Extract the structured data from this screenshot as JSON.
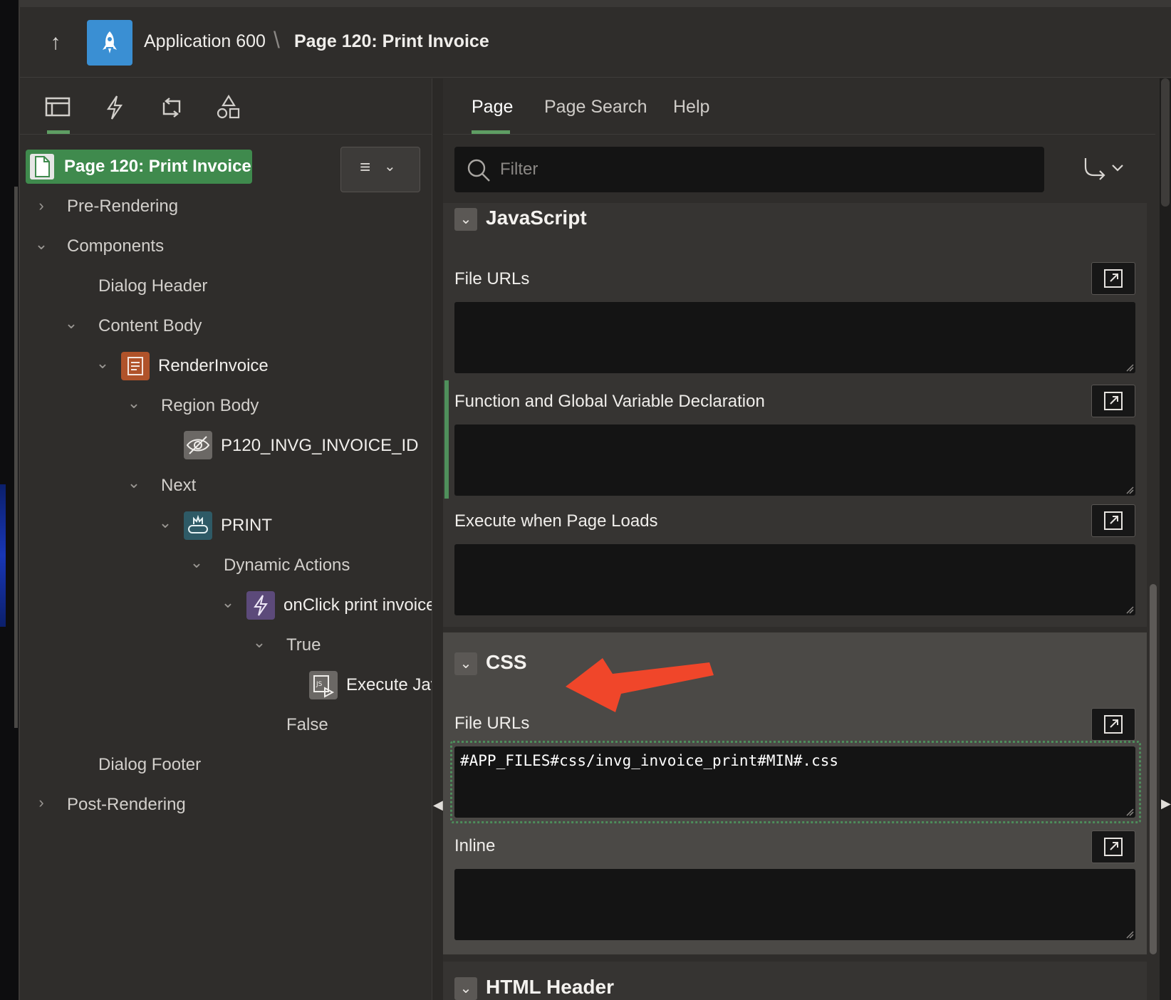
{
  "header": {
    "app_name": "Application 600",
    "separator": "\\",
    "page_name": "Page 120: Print Invoice"
  },
  "left_toolbar": {
    "icons": [
      "rendering-tree-icon",
      "dynamic-actions-icon",
      "processing-icon",
      "shared-components-icon"
    ]
  },
  "tree": {
    "root": "Page 120: Print Invoice",
    "nodes": {
      "pre_rendering": "Pre-Rendering",
      "components": "Components",
      "dialog_header": "Dialog Header",
      "content_body": "Content Body",
      "render_invoice": "RenderInvoice",
      "region_body": "Region Body",
      "invoice_item": "P120_INVG_INVOICE_ID",
      "next": "Next",
      "print": "PRINT",
      "dynamic_actions": "Dynamic Actions",
      "onclick": "onClick print invoice",
      "true_branch": "True",
      "execute": "Execute JavaScript Code",
      "false_branch": "False",
      "dialog_footer": "Dialog Footer",
      "post_rendering": "Post-Rendering"
    }
  },
  "right_tabs": [
    "Page",
    "Page Search",
    "Help"
  ],
  "filter": {
    "placeholder": "Filter"
  },
  "groups": {
    "javascript": {
      "title": "JavaScript",
      "file_urls_label": "File URLs",
      "function_label": "Function and Global Variable Declaration",
      "execute_label": "Execute when Page Loads"
    },
    "css": {
      "title": "CSS",
      "file_urls_label": "File URLs",
      "file_urls_value": "#APP_FILES#css/invg_invoice_print#MIN#.css",
      "inline_label": "Inline"
    },
    "html_header": {
      "title": "HTML Header"
    }
  },
  "colors": {
    "accent_green": "#3f8a4d",
    "app_icon_blue": "#3a8fd3",
    "annotation_arrow": "#f0462a"
  }
}
